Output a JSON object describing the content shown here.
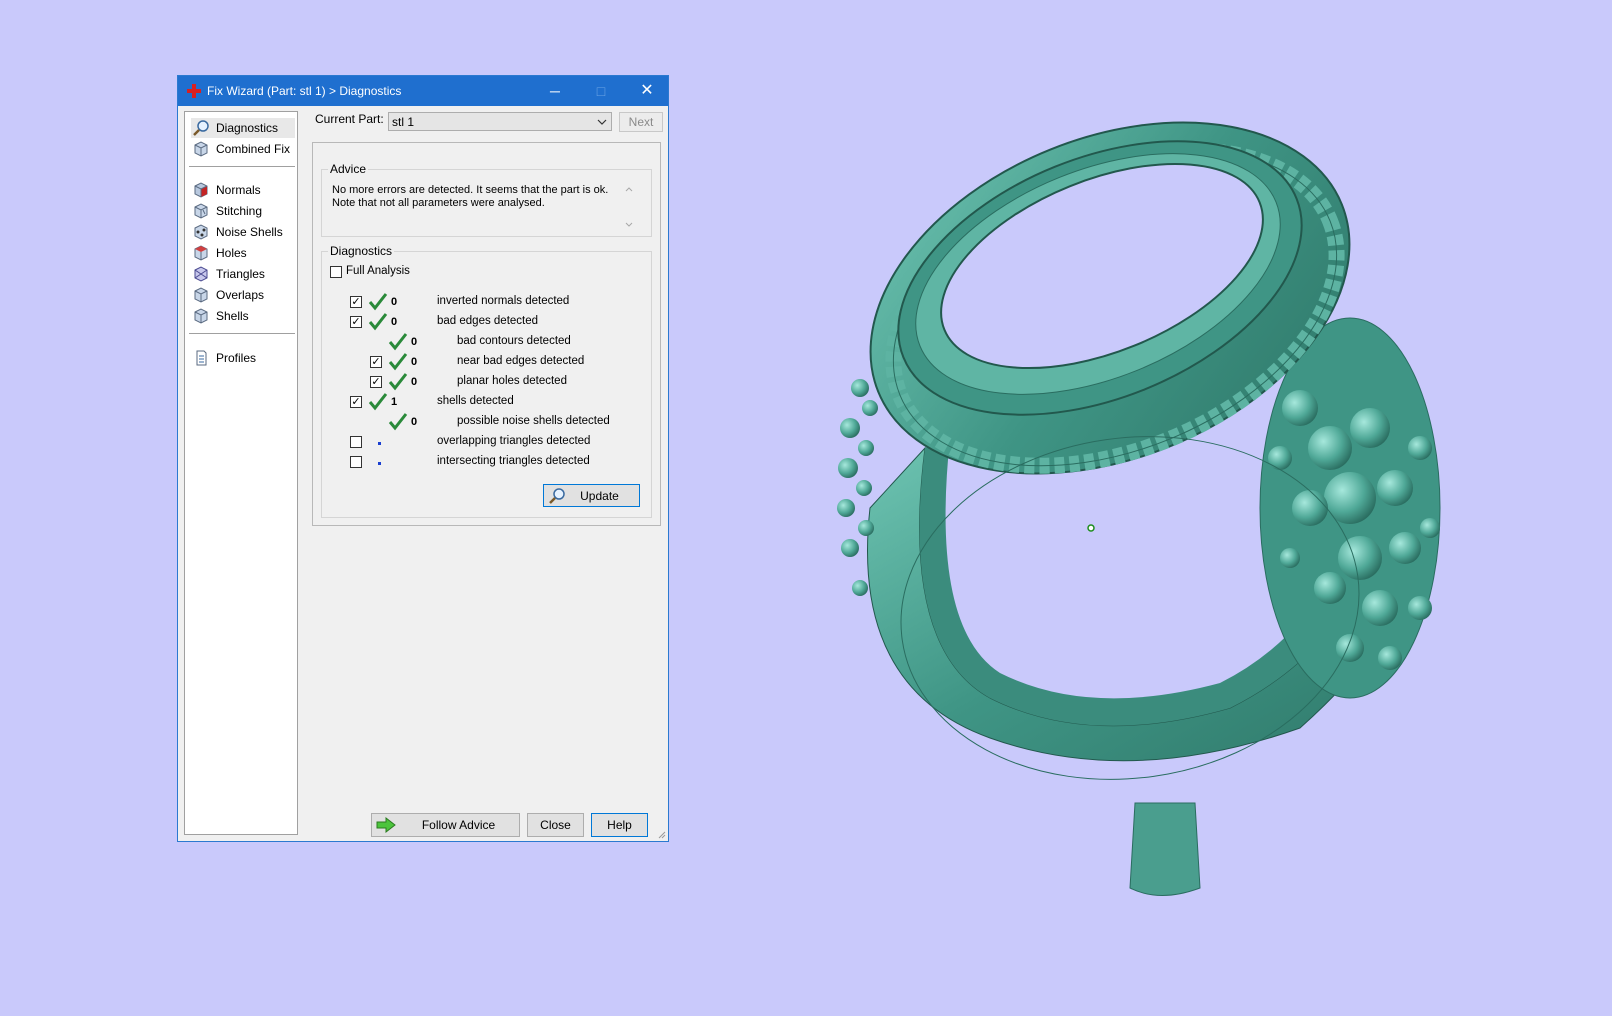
{
  "window": {
    "title": "Fix Wizard (Part: stl 1) > Diagnostics",
    "minimize_glyph": "─",
    "maximize_glyph": "□",
    "close_glyph": "✕"
  },
  "sidebar": {
    "items": [
      {
        "label": "Diagnostics",
        "icon": "magnifier-icon",
        "selected": true
      },
      {
        "label": "Combined Fix",
        "icon": "cube-icon"
      },
      {
        "label": "Normals",
        "icon": "normals-cube-icon"
      },
      {
        "label": "Stitching",
        "icon": "stitching-cube-icon"
      },
      {
        "label": "Noise Shells",
        "icon": "noise-shells-icon"
      },
      {
        "label": "Holes",
        "icon": "holes-cube-icon"
      },
      {
        "label": "Triangles",
        "icon": "triangles-icon"
      },
      {
        "label": "Overlaps",
        "icon": "overlaps-icon"
      },
      {
        "label": "Shells",
        "icon": "shells-icon"
      },
      {
        "label": "Profiles",
        "icon": "document-icon"
      }
    ]
  },
  "current_part": {
    "label": "Current Part:",
    "value": "stl 1",
    "next_label": "Next"
  },
  "advice": {
    "title": "Advice",
    "text_line1": "No more errors are detected. It seems that the part is ok.",
    "text_line2": "Note that not all parameters were analysed."
  },
  "diagnostics": {
    "title": "Diagnostics",
    "full_analysis_label": "Full Analysis",
    "full_analysis_checked": false,
    "rows": [
      {
        "label": "inverted normals detected",
        "count": "0",
        "checked": true,
        "status": "ok"
      },
      {
        "label": "bad edges detected",
        "count": "0",
        "checked": true,
        "status": "ok"
      },
      {
        "label": "bad contours detected",
        "count": "0",
        "status": "ok"
      },
      {
        "label": "near bad edges detected",
        "count": "0",
        "checked": true,
        "status": "ok"
      },
      {
        "label": "planar holes detected",
        "count": "0",
        "checked": true,
        "status": "ok"
      },
      {
        "label": "shells detected",
        "count": "1",
        "checked": true,
        "status": "ok"
      },
      {
        "label": "possible noise shells detected",
        "count": "0",
        "status": "ok"
      },
      {
        "label": "overlapping triangles detected",
        "checked": false,
        "status": "not-analysed"
      },
      {
        "label": "intersecting triangles detected",
        "checked": false,
        "status": "not-analysed"
      }
    ],
    "update_label": "Update",
    "check_glyph": "✓"
  },
  "footer": {
    "follow_advice_label": "Follow Advice",
    "close_label": "Close",
    "help_label": "Help"
  },
  "colors": {
    "background": "#c9c9fb",
    "titlebar": "#1f6fcf",
    "model": "#4fa897",
    "checkmark": "#2a8a3a"
  }
}
